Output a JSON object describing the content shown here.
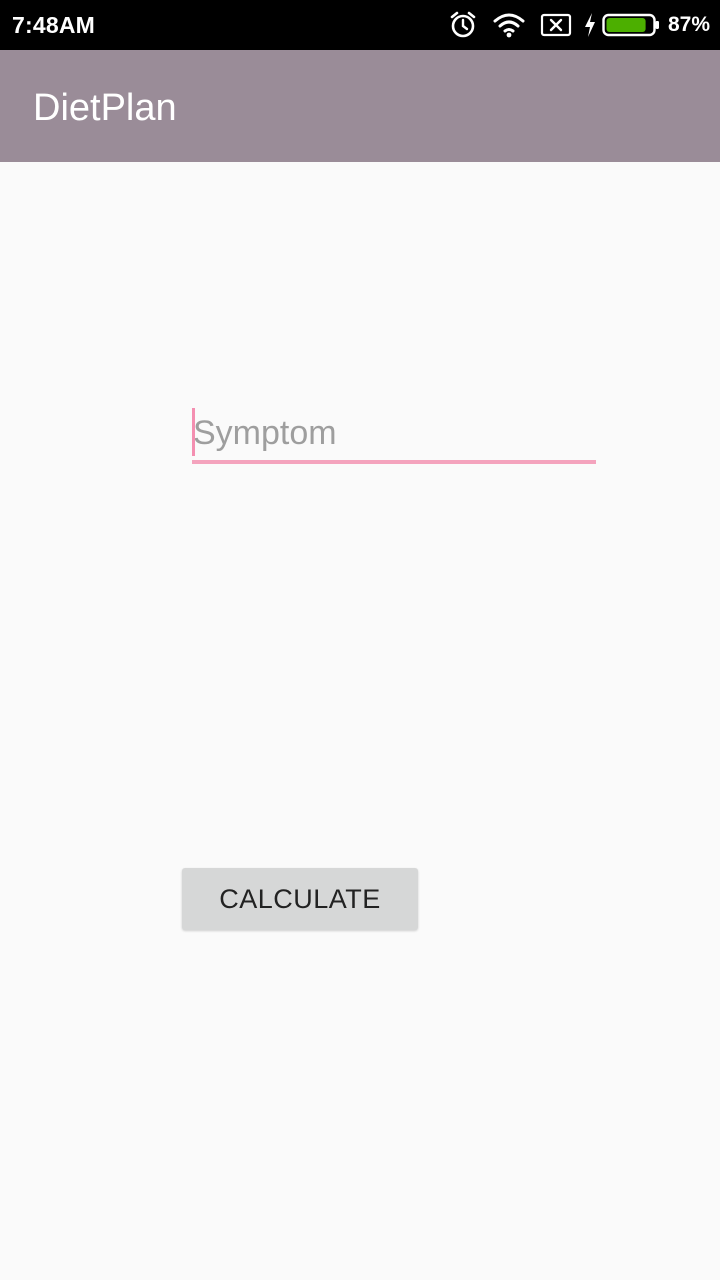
{
  "status_bar": {
    "time": "7:48AM",
    "battery_percent": "87%",
    "icons": [
      "alarm-icon",
      "wifi-icon",
      "no-sim-icon",
      "charging-icon",
      "battery-icon"
    ],
    "battery_level": 0.87,
    "battery_color": "#4caf00"
  },
  "app_bar": {
    "title": "DietPlan",
    "color": "#9a8c98"
  },
  "form": {
    "symptom_placeholder": "Symptom",
    "symptom_value": "",
    "accent_color": "#f48fb1",
    "calculate_label": "CALCULATE"
  }
}
